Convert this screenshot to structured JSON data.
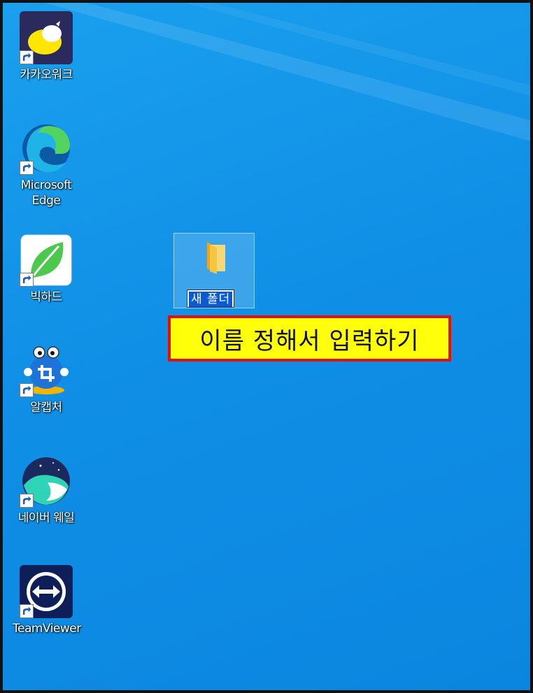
{
  "desktop": {
    "icons": [
      {
        "label": "카카오워크",
        "icon": "kakaowork-icon"
      },
      {
        "label": "Microsoft\nEdge",
        "icon": "edge-icon"
      },
      {
        "label": "빅하드",
        "icon": "bighard-leaf-icon"
      },
      {
        "label": "알캡처",
        "icon": "alcapture-icon"
      },
      {
        "label": "네이버 웨일",
        "icon": "whale-icon"
      },
      {
        "label": "TeamViewer",
        "icon": "teamviewer-icon"
      }
    ],
    "new_folder": {
      "name_value": "새 폴더",
      "icon": "folder-icon"
    }
  },
  "annotation": {
    "text": "이름 정해서 입력하기",
    "bg_color": "#ffff0a",
    "border_color": "#e01010"
  },
  "colors": {
    "desktop_blue": "#108fe6"
  }
}
